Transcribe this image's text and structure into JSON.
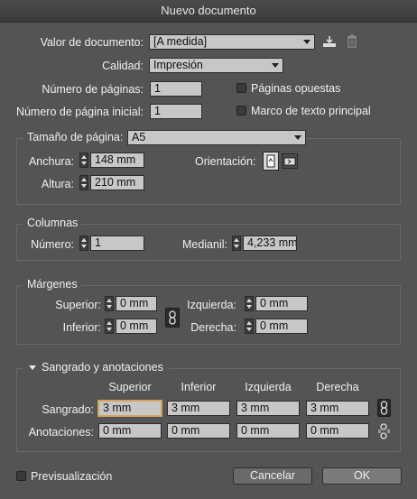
{
  "window": {
    "title": "Nuevo documento"
  },
  "document": {
    "valor_label": "Valor de documento:",
    "valor_value": "[A medida]",
    "calidad_label": "Calidad:",
    "calidad_value": "Impresión",
    "num_paginas_label": "Número de páginas:",
    "num_paginas_value": "1",
    "num_pagina_inicial_label": "Número de página inicial:",
    "num_pagina_inicial_value": "1",
    "paginas_opuestas_label": "Páginas opuestas",
    "marco_texto_label": "Marco de texto principal"
  },
  "page_size": {
    "legend": "Tamaño de página:",
    "value": "A5",
    "anchura_label": "Anchura:",
    "anchura_value": "148 mm",
    "altura_label": "Altura:",
    "altura_value": "210 mm",
    "orientacion_label": "Orientación:"
  },
  "columns": {
    "legend": "Columnas",
    "numero_label": "Número:",
    "numero_value": "1",
    "medianil_label": "Medianil:",
    "medianil_value": "4,233 mm"
  },
  "margins": {
    "legend": "Márgenes",
    "superior_label": "Superior:",
    "superior_value": "0 mm",
    "inferior_label": "Inferior:",
    "inferior_value": "0 mm",
    "izquierda_label": "Izquierda:",
    "izquierda_value": "0 mm",
    "derecha_label": "Derecha:",
    "derecha_value": "0 mm"
  },
  "bleed": {
    "legend": "Sangrado y anotaciones",
    "headers": [
      "Superior",
      "Inferior",
      "Izquierda",
      "Derecha"
    ],
    "sangrado_label": "Sangrado:",
    "sangrado_values": [
      "3 mm",
      "3 mm",
      "3 mm",
      "3 mm"
    ],
    "anotaciones_label": "Anotaciones:",
    "anotaciones_values": [
      "0 mm",
      "0 mm",
      "0 mm",
      "0 mm"
    ]
  },
  "footer": {
    "preview_label": "Previsualización",
    "cancel_label": "Cancelar",
    "ok_label": "OK"
  }
}
